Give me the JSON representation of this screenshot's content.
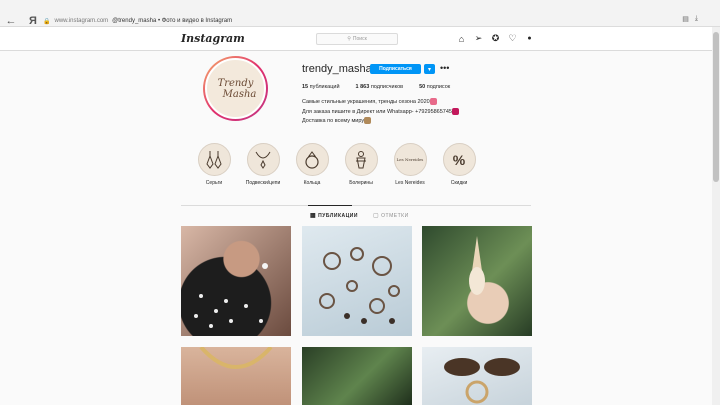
{
  "browser": {
    "url_host": "www.instagram.com",
    "tab_title": "@trendy_masha • Фото и видео в Instagram"
  },
  "header": {
    "logo": "Instagram",
    "search_placeholder": "Поиск"
  },
  "profile": {
    "username": "trendy_masha",
    "avatar_text_line1": "Trendy",
    "avatar_text_line2": "Masha",
    "follow_label": "Подписаться",
    "dropdown_label": "▾",
    "more_label": "•••",
    "posts_count": "15",
    "posts_label": "публикаций",
    "followers_count": "1 863",
    "followers_label": "подписчиков",
    "following_count": "50",
    "following_label": "подписок",
    "bio_line1": "Самые стильные украшения, тренды сезона 2020",
    "bio_line2": "Для заказа пишите в Директ или Whatsapp- +79295865745",
    "bio_line3": "Доставка по всему миру"
  },
  "highlights": [
    {
      "label": "Серьги",
      "icon": "earrings-icon",
      "glyph": "♢"
    },
    {
      "label": "Подвески/цепи",
      "icon": "necklace-icon",
      "glyph": "◇"
    },
    {
      "label": "Кольца",
      "icon": "ring-icon",
      "glyph": "◎"
    },
    {
      "label": "Болерины",
      "icon": "bolero-icon",
      "glyph": "♀"
    },
    {
      "label": "Les Nereides",
      "icon": "les-nereides-logo",
      "glyph": ""
    },
    {
      "label": "Скидки",
      "icon": "percent-icon",
      "glyph": "%"
    }
  ],
  "tabs": {
    "publications": "ПУБЛИКАЦИИ",
    "tagged": "ОТМЕТКИ"
  },
  "highlight_logo_text": "Les Nereides",
  "colors": {
    "follow_blue": "#0095f6",
    "highlight_bg": "#efe6da"
  }
}
